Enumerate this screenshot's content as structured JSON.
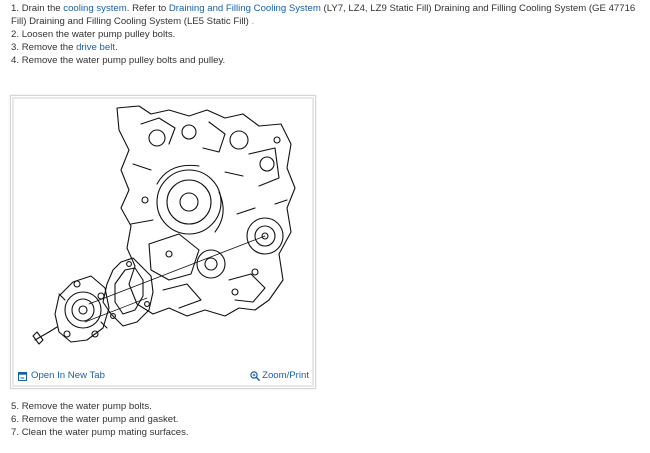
{
  "steps_top": [
    {
      "num": "1.",
      "t1": "Drain the ",
      "link1": "cooling system",
      "t2": ". Refer to ",
      "link2": "Draining and Filling Cooling System",
      "t3": " (LY7, LZ4, LZ9 Static Fill) Draining and Filling Cooling System (GE 47716 Fill) Draining and Filling Cooling System (LE5 Static Fill)",
      "t4": " ."
    },
    {
      "num": "2.",
      "text": "Loosen the water pump pulley bolts."
    },
    {
      "num": "3.",
      "t1": "Remove the ",
      "link1": "drive belt",
      "t2": "."
    },
    {
      "num": "4.",
      "text": "Remove the water pump pulley bolts and pulley."
    }
  ],
  "figure": {
    "open_tab_label": "Open In New Tab",
    "open_tab_icon": "open-in-new-tab-icon",
    "zoom_label": "Zoom/Print",
    "zoom_icon": "magnifier-icon",
    "link_color": "#1a5fa8"
  },
  "steps_bottom": [
    {
      "num": "5.",
      "text": "Remove the water pump bolts."
    },
    {
      "num": "6.",
      "text": "Remove the water pump and gasket."
    },
    {
      "num": "7.",
      "text": "Clean the water pump mating surfaces."
    }
  ]
}
